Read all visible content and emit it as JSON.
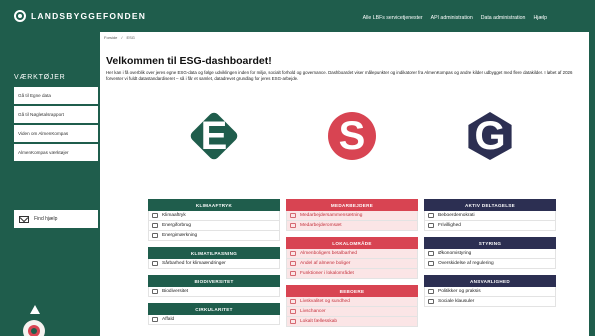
{
  "header": {
    "brand": "LANDSBYGGEFONDEN",
    "nav": [
      "Alle LBFs servicetjenester",
      "API administration",
      "Data administration",
      "Hjælp"
    ]
  },
  "sidebar": {
    "title": "VÆRKTØJER",
    "items": [
      "Gå til Egne data",
      "Gå til Nøgletalsrapport",
      "Viden om AlmenKompas",
      "AlmenKompas værktøjer"
    ],
    "help": "Find hjælp"
  },
  "breadcrumb": [
    "Forside",
    "/",
    "ESG"
  ],
  "page": {
    "title": "Velkommen til ESG-dashboardet!",
    "intro": "Her kan i få overblik over jeres egne ESG-data og følge udviklingen inden for miljø, socialt forhold og governance. Dashboardet viser målepunkter og indikatorer fra AlmenKompas og andre kilder udbygget med flere datakilder. I løbet af 2026 forventer vi fuldt datastandardiseret – så i får et samlet, datadrevet grundlag for jeres ESG-arbejde."
  },
  "columns": {
    "e": {
      "letter": "E",
      "color": "#1f5d4c",
      "categories": [
        {
          "title": "KLIMAAFTRYK",
          "items": [
            "Klimaaftryk",
            "Energiforbrug",
            "Energimærkning"
          ]
        },
        {
          "title": "KLIMATILPASNING",
          "items": [
            "Sårbarhed for klimaændringer"
          ]
        },
        {
          "title": "BIODIVERSITET",
          "items": [
            "Biodiversitet"
          ]
        },
        {
          "title": "CIRKULARITET",
          "items": [
            "Affald"
          ]
        }
      ]
    },
    "s": {
      "letter": "S",
      "color": "#d84452",
      "categories": [
        {
          "title": "MEDARBEJDERE",
          "items": [
            "Medarbejdersammensætning",
            "Medarbejderomsæt"
          ]
        },
        {
          "title": "LOKALOMRÅDE",
          "items": [
            "Almenboligers betalbarhed",
            "Andel af almene boliger",
            "Funktioner i lokalområdet"
          ]
        },
        {
          "title": "BEBOERE",
          "items": [
            "Livskvalitet og sundhed",
            "Livschancer",
            "Lokalt fællesskab"
          ]
        }
      ]
    },
    "g": {
      "letter": "G",
      "color": "#2c2f52",
      "categories": [
        {
          "title": "AKTIV DELTAGELSE",
          "items": [
            "Beboerdemokrati",
            "Frivillighed"
          ]
        },
        {
          "title": "STYRING",
          "items": [
            "Økonomistyring",
            "Overskidelse af regulering"
          ]
        },
        {
          "title": "ANSVARLIGHED",
          "items": [
            "Politikker og praksis",
            "Sociale klausuler"
          ]
        }
      ]
    }
  }
}
